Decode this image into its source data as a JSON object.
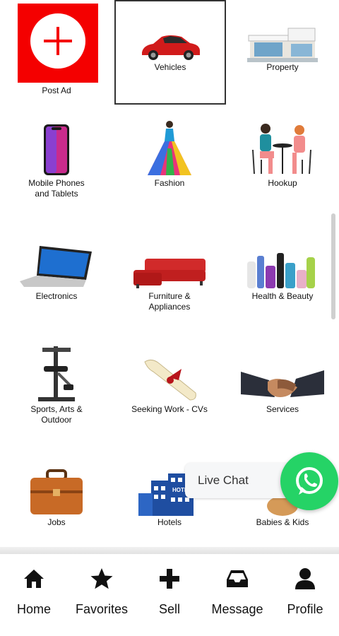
{
  "categories": {
    "post_ad": "Post Ad",
    "vehicles": "Vehicles",
    "property": "Property",
    "mobile_line1": "Mobile Phones",
    "mobile_line2": "and Tablets",
    "fashion": "Fashion",
    "hookup": "Hookup",
    "electronics": "Electronics",
    "furniture_line1": "Furniture &",
    "furniture_line2": "Appliances",
    "health": "Health & Beauty",
    "sports_line1": "Sports, Arts &",
    "sports_line2": "Outdoor",
    "seeking_work": "Seeking Work - CVs",
    "services": "Services",
    "jobs": "Jobs",
    "hotels": "Hotels",
    "hotel_sign": "HOTEL",
    "babies": "Babies & Kids"
  },
  "chat": {
    "label": "Live Chat"
  },
  "bottom_nav": {
    "home": "Home",
    "favorites": "Favorites",
    "sell": "Sell",
    "message": "Message",
    "profile": "Profile"
  },
  "colors": {
    "post_ad_red": "#f40000",
    "whatsapp_green": "#25d366"
  }
}
